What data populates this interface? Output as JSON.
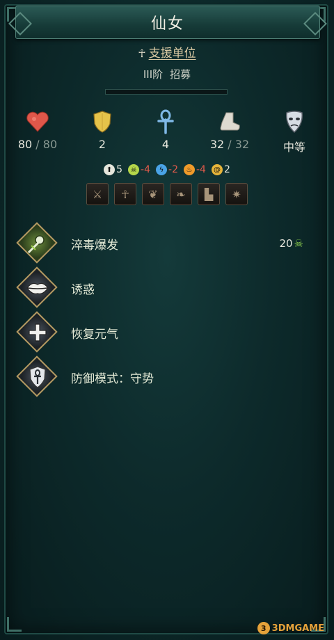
{
  "title": "仙女",
  "unit_type": "支援单位",
  "tier": "III阶",
  "recruit": "招募",
  "stats": {
    "hp_current": "80",
    "hp_max": "/ 80",
    "defense": "2",
    "support": "4",
    "move_current": "32",
    "move_max": "/ 32",
    "morale": "中等"
  },
  "resistances": [
    {
      "icon": "physical-shield-icon",
      "value": "5",
      "color": "#e6e6dc"
    },
    {
      "icon": "blight-skull-icon",
      "value": "-4",
      "color": "#e05a4a"
    },
    {
      "icon": "lightning-icon",
      "value": "-2",
      "color": "#e05a4a"
    },
    {
      "icon": "fire-icon",
      "value": "-4",
      "color": "#e05a4a"
    },
    {
      "icon": "spirit-spiral-icon",
      "value": "2",
      "color": "#e6e6dc"
    }
  ],
  "traits": [
    "crossed-weapons-icon",
    "ankh-icon",
    "fairy-wings-icon",
    "leaf-icon",
    "boot-icon",
    "sun-burst-icon"
  ],
  "abilities": [
    {
      "name": "淬毒爆发",
      "cost": "20",
      "cost_icon": "green-skull-icon",
      "icon": "poison-burst-icon"
    },
    {
      "name": "诱惑",
      "icon": "lips-icon"
    },
    {
      "name": "恢复元气",
      "icon": "restore-icon"
    },
    {
      "name": "防御模式：守势",
      "icon": "ankh-shield-icon"
    }
  ],
  "watermark": "3DMGAME",
  "colors": {
    "background": "#0d2a2b",
    "accent_gold": "#b59a62",
    "negative": "#e05a4a",
    "blight_green": "#8fd14f"
  }
}
